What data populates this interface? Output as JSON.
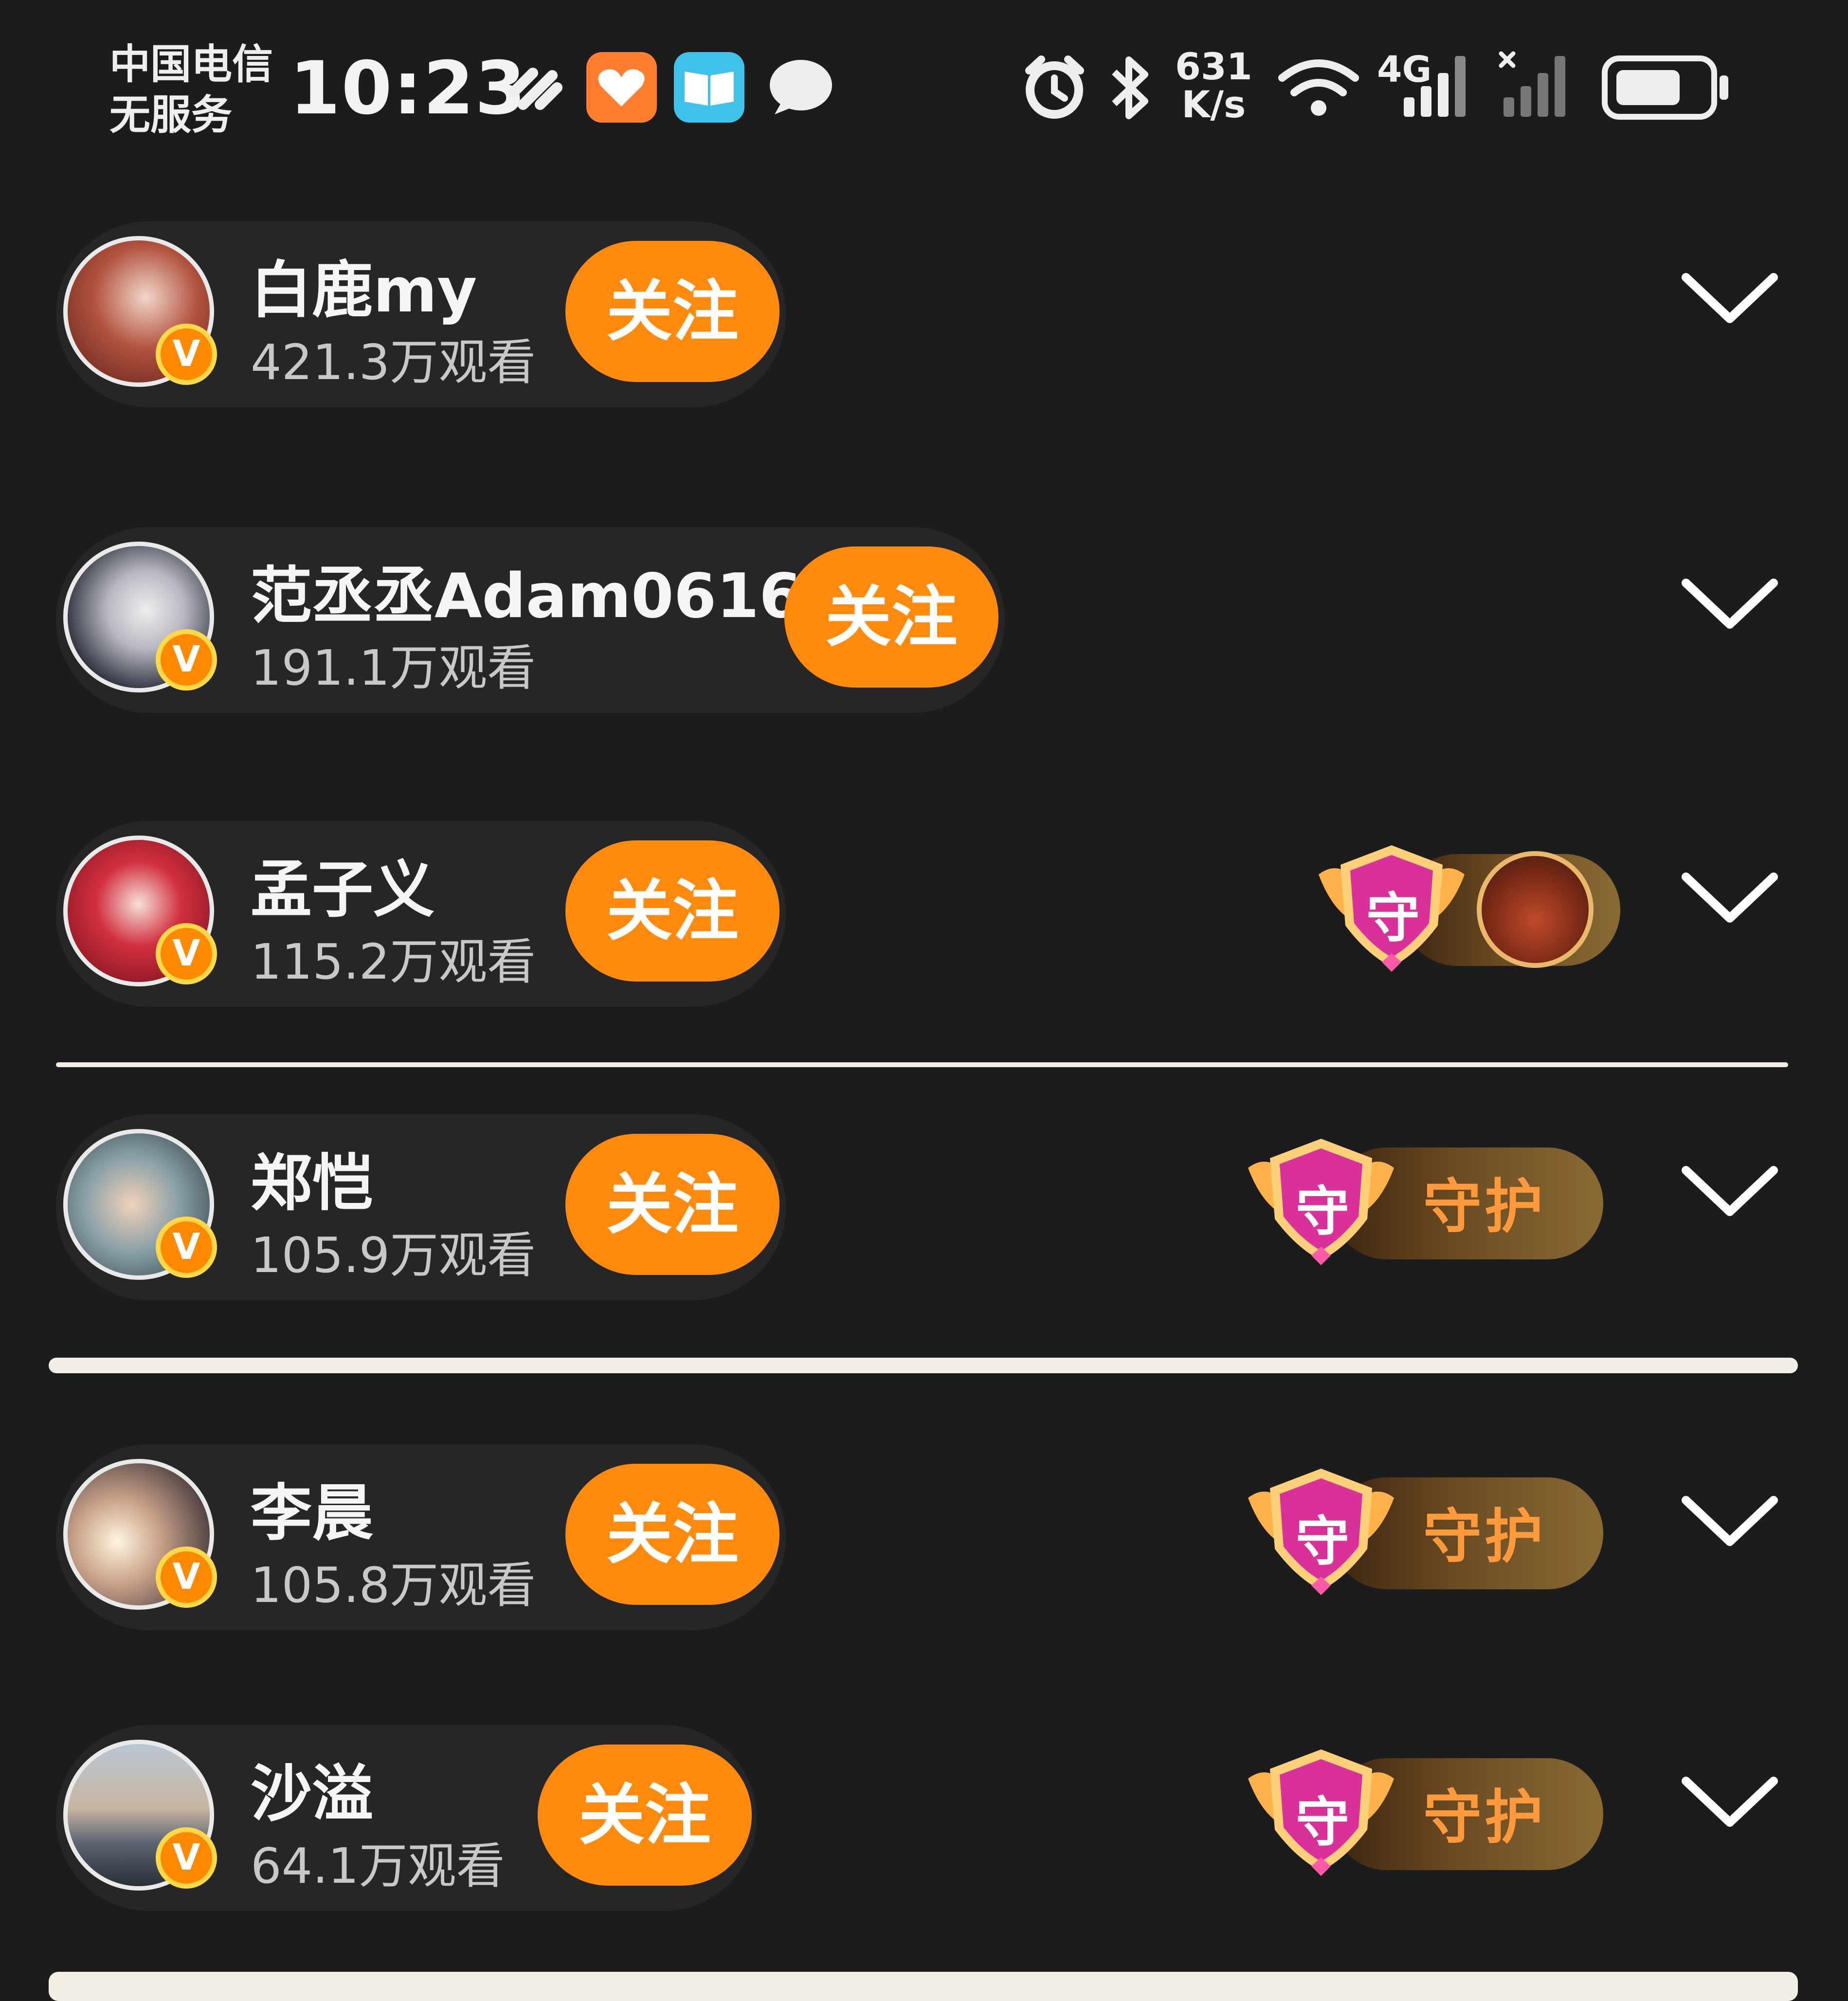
{
  "status_bar": {
    "carrier_line1": "中国电信",
    "carrier_line2": "无服务",
    "time": "10:23",
    "net_speed_value": "631",
    "net_speed_unit": "K/s",
    "signal_label": "4G",
    "icons": [
      "link-icon",
      "app-health-icon",
      "app-book-icon",
      "chat-bubble-icon",
      "alarm-icon",
      "bluetooth-icon",
      "wifi-icon",
      "signal-icon",
      "no-signal-icon",
      "battery-icon"
    ]
  },
  "follow_label": "关注",
  "guard_label": "守护",
  "guard_badge_char": "守",
  "verified_char": "V",
  "colors": {
    "accent": "#ff8a0d",
    "background": "#1c1c1c",
    "pill": "#262626",
    "guard_text": "#ff9a3c"
  },
  "streamers": [
    {
      "name": "白鹿my",
      "views": "421.3万观看",
      "badge": "none"
    },
    {
      "name": "范丞丞Adam0616",
      "views": "191.1万观看",
      "badge": "none"
    },
    {
      "name": "孟子义",
      "views": "115.2万观看",
      "badge": "guard-avatar"
    },
    {
      "name": "郑恺",
      "views": "105.9万观看",
      "badge": "guard-label"
    },
    {
      "name": "李晨",
      "views": "105.8万观看",
      "badge": "guard-label"
    },
    {
      "name": "沙溢",
      "views": "64.1万观看",
      "badge": "guard-label"
    }
  ]
}
